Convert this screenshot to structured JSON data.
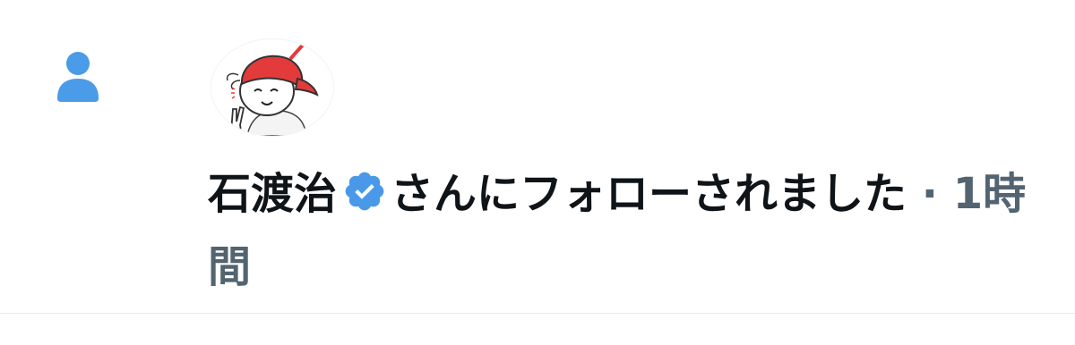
{
  "notification": {
    "user_name": "石渡治",
    "message_text": "さんにフォローされました",
    "separator": "·",
    "time_ago": "1時間",
    "verified": true,
    "icon": "person-icon",
    "badge_icon": "verified-badge-icon"
  },
  "colors": {
    "icon_blue": "#4a9be8",
    "badge_blue": "#4a99e9",
    "text_primary": "#0f1419",
    "text_secondary": "#536471",
    "divider": "#e6e9ec",
    "cap_red": "#e33b3b"
  }
}
